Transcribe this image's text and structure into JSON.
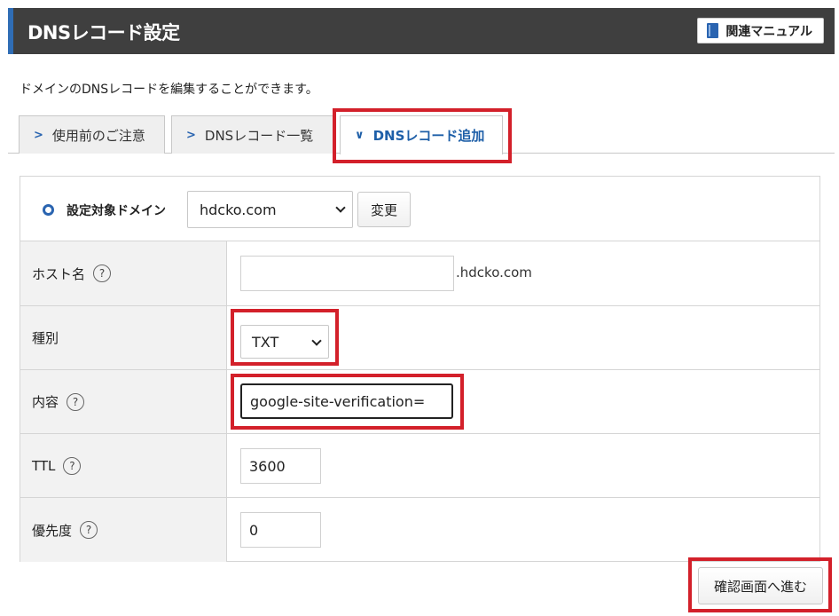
{
  "header": {
    "title": "DNSレコード設定",
    "manual_label": "関連マニュアル"
  },
  "description": "ドメインのDNSレコードを編集することができます。",
  "tabs": [
    {
      "label": "使用前のご注意",
      "active": false
    },
    {
      "label": "DNSレコード一覧",
      "active": false
    },
    {
      "label": "DNSレコード追加",
      "active": true
    }
  ],
  "domain_section": {
    "label": "設定対象ドメイン",
    "selected_domain": "hdcko.com",
    "change_label": "変更"
  },
  "form": {
    "host": {
      "label": "ホスト名",
      "value": "",
      "suffix": ".hdcko.com"
    },
    "type": {
      "label": "種別",
      "selected": "TXT"
    },
    "content": {
      "label": "内容",
      "value": "google-site-verification="
    },
    "ttl": {
      "label": "TTL",
      "value": "3600"
    },
    "priority": {
      "label": "優先度",
      "value": "0"
    }
  },
  "help_glyph": "?",
  "confirm_label": "確認画面へ進む",
  "colors": {
    "header_bg": "#3f3f3f",
    "accent": "#2a64b0",
    "highlight": "#d3202a"
  }
}
